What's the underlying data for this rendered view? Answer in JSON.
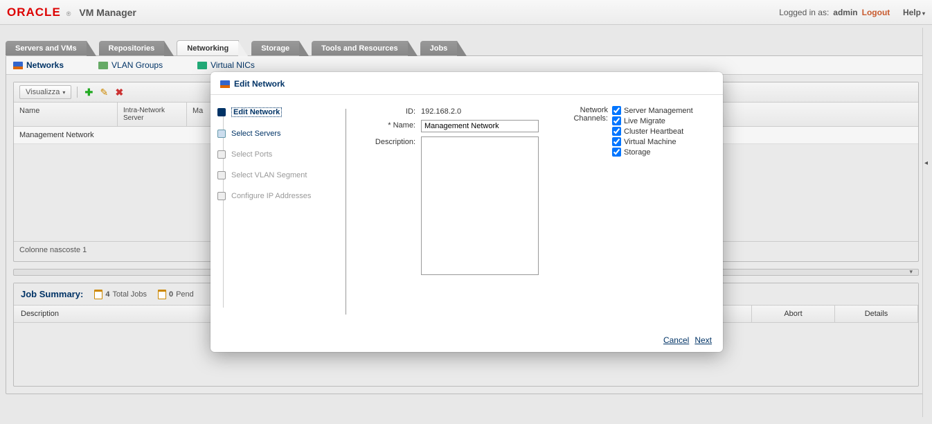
{
  "header": {
    "brand_main": "ORACLE",
    "brand_reg": "®",
    "product": "VM Manager",
    "logged_in_label": "Logged in as:",
    "user": "admin",
    "logout": "Logout",
    "help": "Help"
  },
  "tabs": [
    "Servers and VMs",
    "Repositories",
    "Networking",
    "Storage",
    "Tools and Resources",
    "Jobs"
  ],
  "active_tab_index": 2,
  "subnav": {
    "networks": "Networks",
    "vlan": "VLAN Groups",
    "vnic": "Virtual NICs"
  },
  "toolbar": {
    "visualizza": "Visualizza"
  },
  "table": {
    "col_name": "Name",
    "col_intra": "Intra-Network Server",
    "col_ma": "Ma",
    "row0_name": "Management Network",
    "hidden_cols": "Colonne nascoste 1"
  },
  "jobs": {
    "title": "Job Summary:",
    "total_count": "4",
    "total_label": "Total Jobs",
    "pend_count": "0",
    "pend_label": "Pend",
    "col_desc": "Description",
    "col_abort": "Abort",
    "col_details": "Details"
  },
  "dialog": {
    "title": "Edit Network",
    "steps": [
      "Edit Network",
      "Select Servers",
      "Select Ports",
      "Select VLAN Segment",
      "Configure IP Addresses"
    ],
    "id_label": "ID:",
    "id_value": "192.168.2.0",
    "name_label": "Name:",
    "name_value": "Management Network",
    "desc_label": "Description:",
    "channels_label": "Network Channels:",
    "channels": [
      "Server Management",
      "Live Migrate",
      "Cluster Heartbeat",
      "Virtual Machine",
      "Storage"
    ],
    "cancel": "Cancel",
    "next": "Next"
  }
}
